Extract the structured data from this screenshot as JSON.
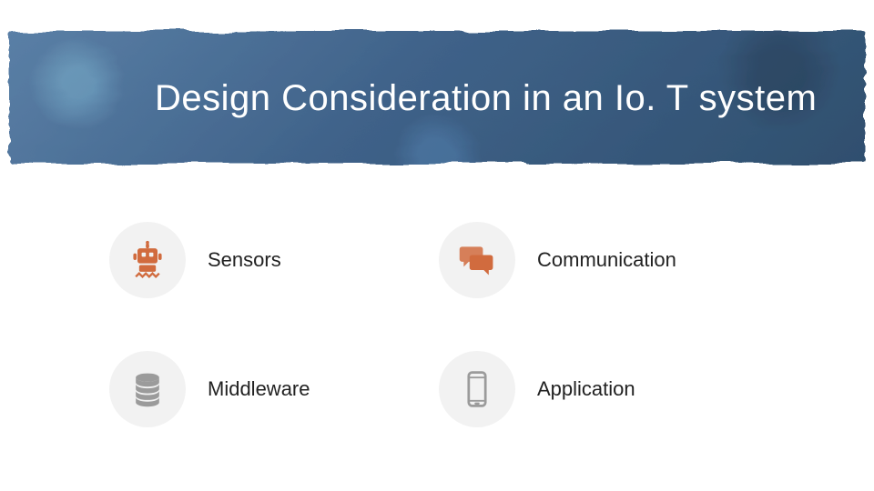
{
  "title": "Design Consideration in an Io. T system",
  "items": [
    {
      "label": "Sensors",
      "icon": "robot-icon"
    },
    {
      "label": "Communication",
      "icon": "chat-icon"
    },
    {
      "label": "Middleware",
      "icon": "database-icon"
    },
    {
      "label": "Application",
      "icon": "phone-icon"
    }
  ],
  "colors": {
    "accent": "#d16b3e",
    "neutral": "#9b9b9b",
    "banner": "#3f6289"
  }
}
